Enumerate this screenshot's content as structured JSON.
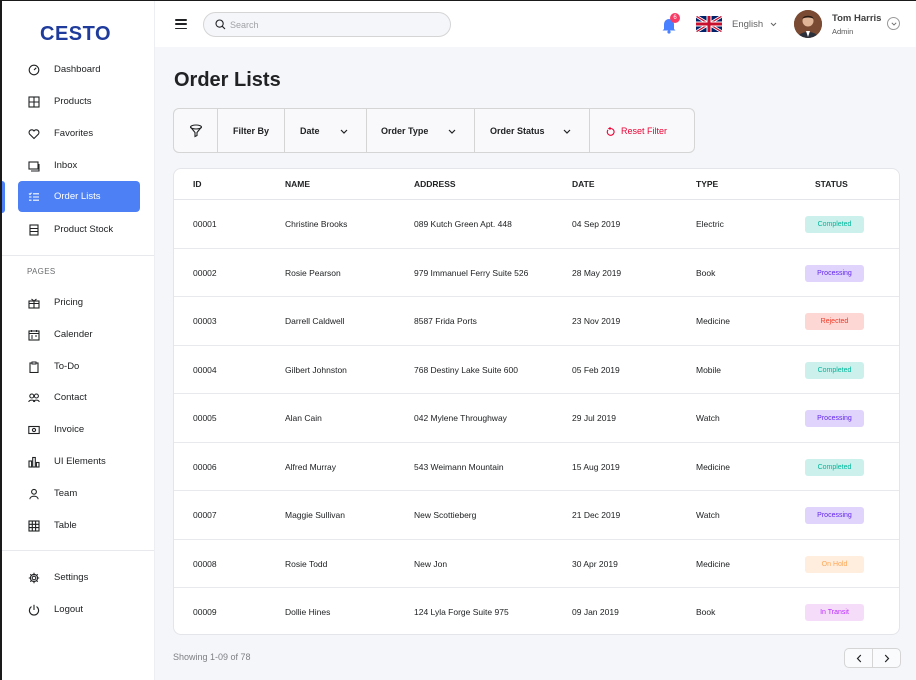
{
  "app": {
    "logo": "CESTO"
  },
  "sidebar": {
    "items": [
      {
        "label": "Dashboard",
        "icon": "dashboard-icon"
      },
      {
        "label": "Products",
        "icon": "grid-icon"
      },
      {
        "label": "Favorites",
        "icon": "heart-icon"
      },
      {
        "label": "Inbox",
        "icon": "inbox-icon"
      },
      {
        "label": "Order Lists",
        "icon": "list-icon",
        "active": true
      },
      {
        "label": "Product Stock",
        "icon": "stock-icon"
      }
    ],
    "pages_label": "PAGES",
    "pages": [
      {
        "label": "Pricing",
        "icon": "gift-icon"
      },
      {
        "label": "Calender",
        "icon": "calendar-icon"
      },
      {
        "label": "To-Do",
        "icon": "clipboard-icon"
      },
      {
        "label": "Contact",
        "icon": "contact-icon"
      },
      {
        "label": "Invoice",
        "icon": "invoice-icon"
      },
      {
        "label": "UI Elements",
        "icon": "chart-icon"
      },
      {
        "label": "Team",
        "icon": "user-icon"
      },
      {
        "label": "Table",
        "icon": "table-icon"
      }
    ],
    "bottom": [
      {
        "label": "Settings",
        "icon": "gear-icon"
      },
      {
        "label": "Logout",
        "icon": "power-icon"
      }
    ]
  },
  "topbar": {
    "search_placeholder": "Search",
    "notifications_count": "6",
    "language": "English",
    "user_name": "Tom Harris",
    "user_role": "Admin"
  },
  "main": {
    "title": "Order Lists",
    "filters": {
      "filter_by": "Filter By",
      "date": "Date",
      "order_type": "Order Type",
      "order_status": "Order Status",
      "reset": "Reset Filter"
    },
    "table": {
      "headers": [
        "ID",
        "NAME",
        "ADDRESS",
        "DATE",
        "TYPE",
        "STATUS"
      ],
      "rows": [
        {
          "id": "00001",
          "name": "Christine Brooks",
          "address": "089 Kutch Green Apt. 448",
          "date": "04 Sep 2019",
          "type": "Electric",
          "status": "Completed",
          "status_kind": "completed"
        },
        {
          "id": "00002",
          "name": "Rosie Pearson",
          "address": "979 Immanuel Ferry Suite 526",
          "date": "28 May 2019",
          "type": "Book",
          "status": "Processing",
          "status_kind": "processing"
        },
        {
          "id": "00003",
          "name": "Darrell Caldwell",
          "address": "8587 Frida Ports",
          "date": "23 Nov 2019",
          "type": "Medicine",
          "status": "Rejected",
          "status_kind": "rejected"
        },
        {
          "id": "00004",
          "name": "Gilbert Johnston",
          "address": "768 Destiny Lake Suite 600",
          "date": "05 Feb 2019",
          "type": "Mobile",
          "status": "Completed",
          "status_kind": "completed"
        },
        {
          "id": "00005",
          "name": "Alan Cain",
          "address": "042 Mylene Throughway",
          "date": "29 Jul 2019",
          "type": "Watch",
          "status": "Processing",
          "status_kind": "processing"
        },
        {
          "id": "00006",
          "name": "Alfred Murray",
          "address": "543 Weimann Mountain",
          "date": "15 Aug 2019",
          "type": "Medicine",
          "status": "Completed",
          "status_kind": "completed"
        },
        {
          "id": "00007",
          "name": "Maggie Sullivan",
          "address": "New Scottieberg",
          "date": "21 Dec 2019",
          "type": "Watch",
          "status": "Processing",
          "status_kind": "processing"
        },
        {
          "id": "00008",
          "name": "Rosie Todd",
          "address": "New Jon",
          "date": "30 Apr 2019",
          "type": "Medicine",
          "status": "On Hold",
          "status_kind": "onhold"
        },
        {
          "id": "00009",
          "name": "Dollie Hines",
          "address": "124 Lyla Forge Suite 975",
          "date": "09 Jan 2019",
          "type": "Book",
          "status": "In Transit",
          "status_kind": "transit"
        }
      ]
    },
    "footer": {
      "showing": "Showing 1-09 of 78"
    }
  },
  "colors": {
    "accent": "#4d80f5",
    "logo": "#1f3c9c",
    "reset": "#ea0234"
  }
}
